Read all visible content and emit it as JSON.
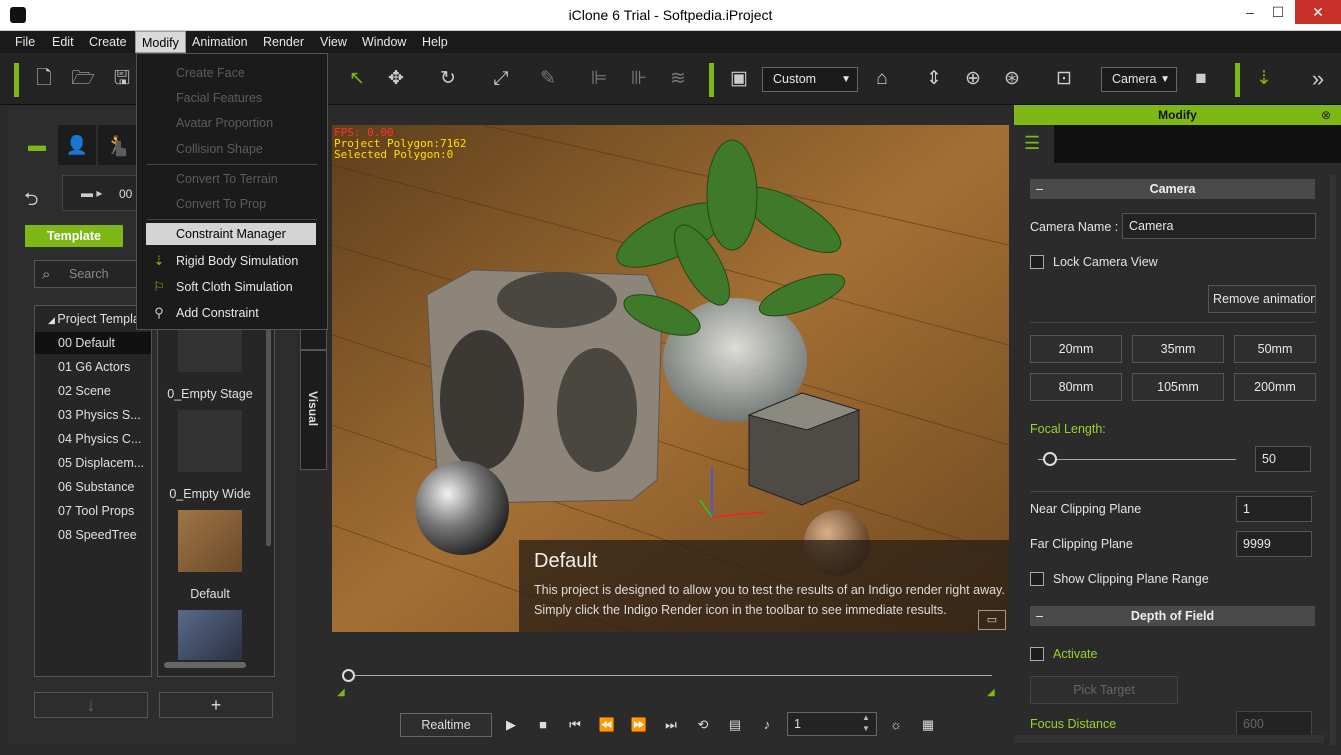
{
  "window": {
    "title": "iClone 6 Trial - Softpedia.iProject",
    "min": "–",
    "max": "☐",
    "close": "✕"
  },
  "menu": [
    "File",
    "Edit",
    "Create",
    "Modify",
    "Animation",
    "Render",
    "View",
    "Window",
    "Help"
  ],
  "toolbar": {
    "view_mode": "Custom",
    "camera": "Camera",
    "more": "»"
  },
  "modify_menu": {
    "items": [
      {
        "label": "Create Face",
        "disabled": true
      },
      {
        "label": "Facial Features",
        "disabled": true
      },
      {
        "label": "Avatar Proportion",
        "disabled": true
      },
      {
        "label": "Collision Shape",
        "disabled": true
      },
      {
        "label": "Convert To Terrain",
        "disabled": true
      },
      {
        "label": "Convert To Prop",
        "disabled": true
      },
      {
        "label": "Constraint Manager",
        "disabled": false
      },
      {
        "label": "Rigid Body Simulation",
        "disabled": false
      },
      {
        "label": "Soft Cloth Simulation",
        "disabled": false
      },
      {
        "label": "Add Constraint",
        "disabled": false
      }
    ]
  },
  "left_panel": {
    "path_label": "00",
    "template_button": "Template",
    "search_placeholder": "Search",
    "tree_root": "Project Templat",
    "tree_items": [
      "00 Default",
      "01 G6 Actors",
      "02 Scene",
      "03 Physics S...",
      "04 Physics C...",
      "05 Displacem...",
      "06 Substance",
      "07 Tool Props",
      "08 SpeedTree"
    ],
    "thumbnails": [
      "0_Empty Stage",
      "0_Empty Wide",
      "Default"
    ],
    "visual_tab": "Visual",
    "down_button": "↓",
    "add_button": "+"
  },
  "viewport": {
    "stats": [
      "FPS: 0.00",
      "Project Polygon:7162",
      "Selected Polygon:0"
    ],
    "info_title": "Default",
    "info_lines": [
      "This project is designed to allow you to test the results of an Indigo render right away.",
      "Simply click the Indigo Render icon in the toolbar to see immediate results."
    ]
  },
  "timeline": {
    "mode": "Realtime",
    "frame": "1"
  },
  "modify_panel": {
    "header": "Modify",
    "camera_section": "Camera",
    "camera_name_label": "Camera Name :",
    "camera_name_value": "Camera",
    "lock_camera_view": "Lock Camera View",
    "remove_animation": "Remove  animation",
    "lenses": [
      "20mm",
      "35mm",
      "50mm",
      "80mm",
      "105mm",
      "200mm"
    ],
    "focal_length_label": "Focal Length:",
    "focal_length_value": "50",
    "focal_slider_fraction": 0.06,
    "near_clip_label": "Near Clipping Plane",
    "near_clip_value": "1",
    "far_clip_label": "Far Clipping Plane",
    "far_clip_value": "9999",
    "show_clip_range": "Show Clipping Plane Range",
    "dof_section": "Depth of Field",
    "activate": "Activate",
    "pick_target": "Pick Target",
    "focus_distance_label": "Focus Distance",
    "focus_distance_value": "600"
  },
  "colors": {
    "accent": "#7db817",
    "menu_bg": "#1a1a1a",
    "panel_bg": "#2b2b2b"
  }
}
